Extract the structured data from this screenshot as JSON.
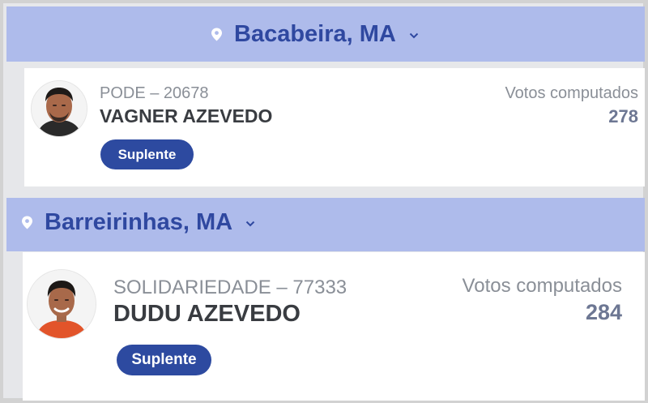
{
  "sections": [
    {
      "city": "Bacabeira, MA",
      "candidate": {
        "party_number": "PODE – 20678",
        "name": "VAGNER AZEVEDO",
        "status": "Suplente",
        "votes_label": "Votos computados",
        "votes": "278"
      }
    },
    {
      "city": "Barreirinhas, MA",
      "candidate": {
        "party_number": "SOLIDARIEDADE – 77333",
        "name": "DUDU AZEVEDO",
        "status": "Suplente",
        "votes_label": "Votos computados",
        "votes": "284"
      }
    }
  ],
  "icons": {
    "location": "location-pin-icon",
    "expand": "chevron-down-icon"
  },
  "colors": {
    "header_bg": "#aebbeb",
    "header_text": "#2f48a0",
    "badge_bg": "#2d4aa0",
    "votes_value": "#6d7793",
    "muted_text": "#8a8f97"
  }
}
